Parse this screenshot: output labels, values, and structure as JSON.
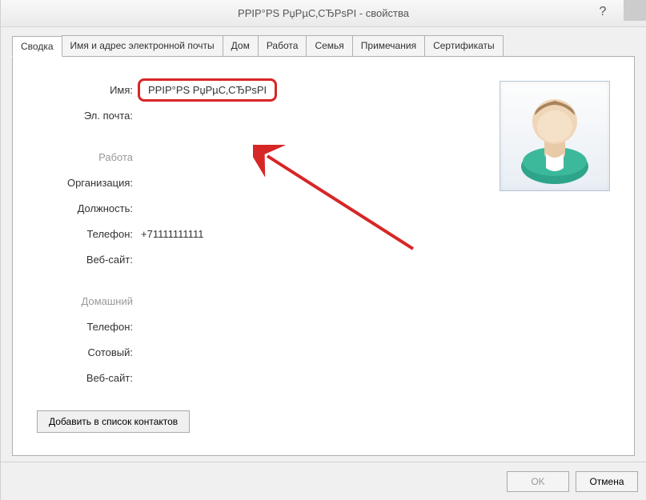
{
  "window": {
    "title": "РРІР°РЅ РџРµС‚СЂРѕРІ - свойства"
  },
  "tabs": [
    {
      "label": "Сводка"
    },
    {
      "label": "Имя и адрес электронной почты"
    },
    {
      "label": "Дом"
    },
    {
      "label": "Работа"
    },
    {
      "label": "Семья"
    },
    {
      "label": "Примечания"
    },
    {
      "label": "Сертификаты"
    }
  ],
  "summary": {
    "name_label": "Имя:",
    "name_value": "РРІР°РЅ РџРµС‚СЂРѕРІ",
    "email_label": "Эл. почта:",
    "email_value": "",
    "work_section": "Работа",
    "org_label": "Организация:",
    "org_value": "",
    "position_label": "Должность:",
    "position_value": "",
    "phone_label": "Телефон:",
    "phone_value": "+71111111111",
    "website_label": "Веб-сайт:",
    "website_value": "",
    "home_section": "Домашний",
    "home_phone_label": "Телефон:",
    "home_phone_value": "",
    "mobile_label": "Сотовый:",
    "mobile_value": "",
    "home_website_label": "Веб-сайт:",
    "home_website_value": ""
  },
  "buttons": {
    "add_contact": "Добавить в список контактов",
    "ok": "OK",
    "cancel": "Отмена"
  },
  "annotation": {
    "arrow_color": "#d72626"
  }
}
